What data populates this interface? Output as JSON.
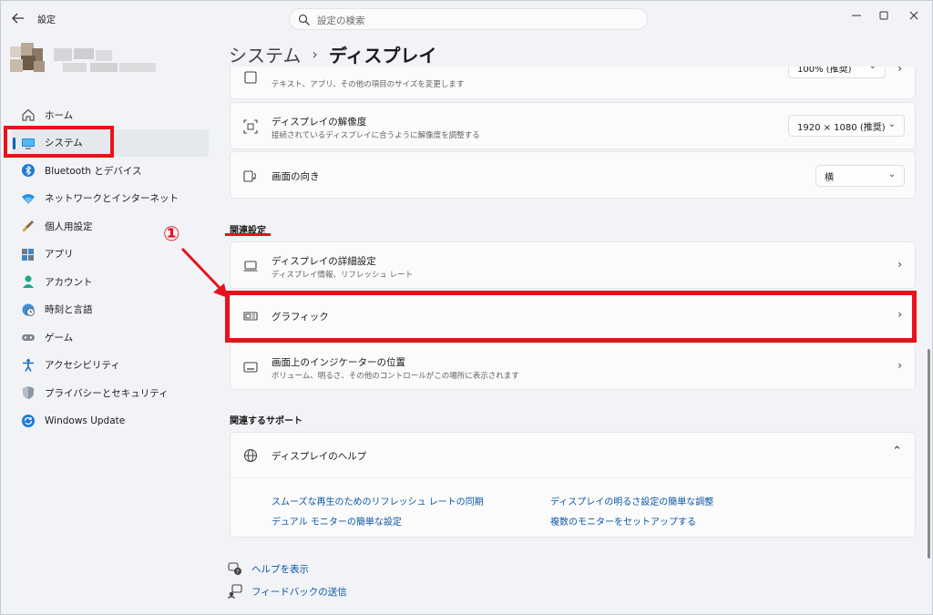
{
  "titlebar": {
    "back_icon": "back-arrow-icon",
    "app_title": "設定",
    "search_placeholder": "設定の検索"
  },
  "sidebar": {
    "items": [
      {
        "label": "ホーム",
        "icon": "home-icon"
      },
      {
        "label": "システム",
        "icon": "monitor-icon",
        "active": true
      },
      {
        "label": "Bluetooth とデバイス",
        "icon": "bluetooth-icon"
      },
      {
        "label": "ネットワークとインターネット",
        "icon": "wifi-icon"
      },
      {
        "label": "個人用設定",
        "icon": "brush-icon"
      },
      {
        "label": "アプリ",
        "icon": "apps-icon"
      },
      {
        "label": "アカウント",
        "icon": "account-icon"
      },
      {
        "label": "時刻と言語",
        "icon": "globe-clock-icon"
      },
      {
        "label": "ゲーム",
        "icon": "gamepad-icon"
      },
      {
        "label": "アクセシビリティ",
        "icon": "accessibility-icon"
      },
      {
        "label": "プライバシーとセキュリティ",
        "icon": "shield-icon"
      },
      {
        "label": "Windows Update",
        "icon": "update-icon"
      }
    ]
  },
  "breadcrumb": {
    "parent": "システム",
    "separator": "›",
    "current": "ディスプレイ"
  },
  "settings": {
    "scale": {
      "subtitle": "テキスト、アプリ、その他の項目のサイズを変更します",
      "value": "100% (推奨)"
    },
    "resolution": {
      "title": "ディスプレイの解像度",
      "subtitle": "接続されているディスプレイに合うように解像度を調整する",
      "value": "1920 × 1080 (推奨)"
    },
    "orientation": {
      "title": "画面の向き",
      "value": "横"
    }
  },
  "related": {
    "heading": "関連設定",
    "items": [
      {
        "title": "ディスプレイの詳細設定",
        "subtitle": "ディスプレイ情報、リフレッシュ レート"
      },
      {
        "title": "グラフィック",
        "subtitle": ""
      },
      {
        "title": "画面上のインジケーターの位置",
        "subtitle": "ボリューム、明るさ、その他のコントロールがこの場所に表示されます"
      }
    ]
  },
  "support": {
    "heading": "関連するサポート",
    "help_title": "ディスプレイのヘルプ",
    "links": [
      "スムーズな再生のためのリフレッシュ レートの同期",
      "ディスプレイの明るさ設定の簡単な調整",
      "デュアル モニターの簡単な設定",
      "複数のモニターをセットアップする"
    ]
  },
  "footer": {
    "help": "ヘルプを表示",
    "feedback": "フィードバックの送信"
  },
  "annotation": {
    "number": "①"
  },
  "colors": {
    "accent": "#005fb8",
    "highlight_red": "#e8121b",
    "link": "#0b57a6"
  }
}
